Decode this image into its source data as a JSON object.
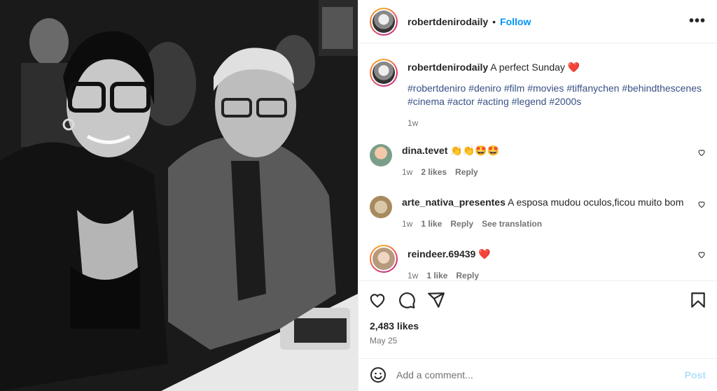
{
  "post": {
    "username": "robertdenirodaily",
    "follow_label": "Follow",
    "dot": "•",
    "more_label": "•••"
  },
  "caption": {
    "username": "robertdenirodaily",
    "text": "A perfect Sunday",
    "emoji": "❤️",
    "hashtags": "#robertdeniro #deniro #film #movies #tiffanychen #behindthescenes #cinema #actor #acting #legend #2000s",
    "age": "1w"
  },
  "comments": [
    {
      "username": "dina.tevet",
      "text": "👏👏🤩🤩",
      "age": "1w",
      "likes": "2 likes",
      "reply": "Reply",
      "extra": ""
    },
    {
      "username": "arte_nativa_presentes",
      "text": "A esposa mudou oculos,ficou muito bom",
      "age": "1w",
      "likes": "1 like",
      "reply": "Reply",
      "extra": "See translation"
    },
    {
      "username": "reindeer.69439",
      "text": "❤️",
      "age": "1w",
      "likes": "1 like",
      "reply": "Reply",
      "extra": ""
    }
  ],
  "stats": {
    "likes": "2,483 likes",
    "date": "May 25"
  },
  "add_comment": {
    "placeholder": "Add a comment...",
    "post_label": "Post"
  },
  "colors": {
    "accent": "#0095f6",
    "hashtag": "#385185",
    "muted": "#737373",
    "post_disabled": "#b2dffc"
  },
  "icons": [
    "heart-icon",
    "comment-icon",
    "share-icon",
    "bookmark-icon",
    "emoji-icon",
    "more-icon"
  ]
}
